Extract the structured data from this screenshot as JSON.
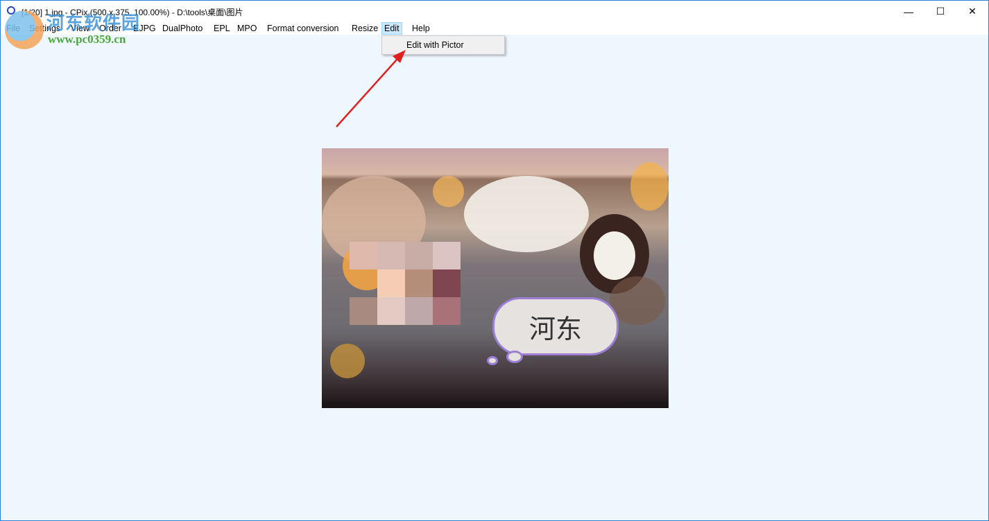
{
  "window": {
    "title": "[1/20] 1.jpg - CPix (500 x 375, 100.00%) - D:\\tools\\桌面\\图片",
    "controls": {
      "minimize": "—",
      "maximize": "☐",
      "close": "✕"
    }
  },
  "menu": {
    "items": [
      "File",
      "Settings",
      "View",
      "Order",
      "EJPG",
      "DualPhoto",
      "EPL",
      "MPO",
      "Format conversion",
      "Resize",
      "Edit",
      "Help"
    ],
    "active": "Edit",
    "dropdown": {
      "items": [
        "Edit with Pictor"
      ]
    }
  },
  "watermark": {
    "name": "河东软件园",
    "url": "www.pc0359.cn"
  },
  "image": {
    "caption_text": "河东",
    "accent": "#9d7fd6"
  },
  "annotation": {
    "arrow_color": "#e02020"
  }
}
